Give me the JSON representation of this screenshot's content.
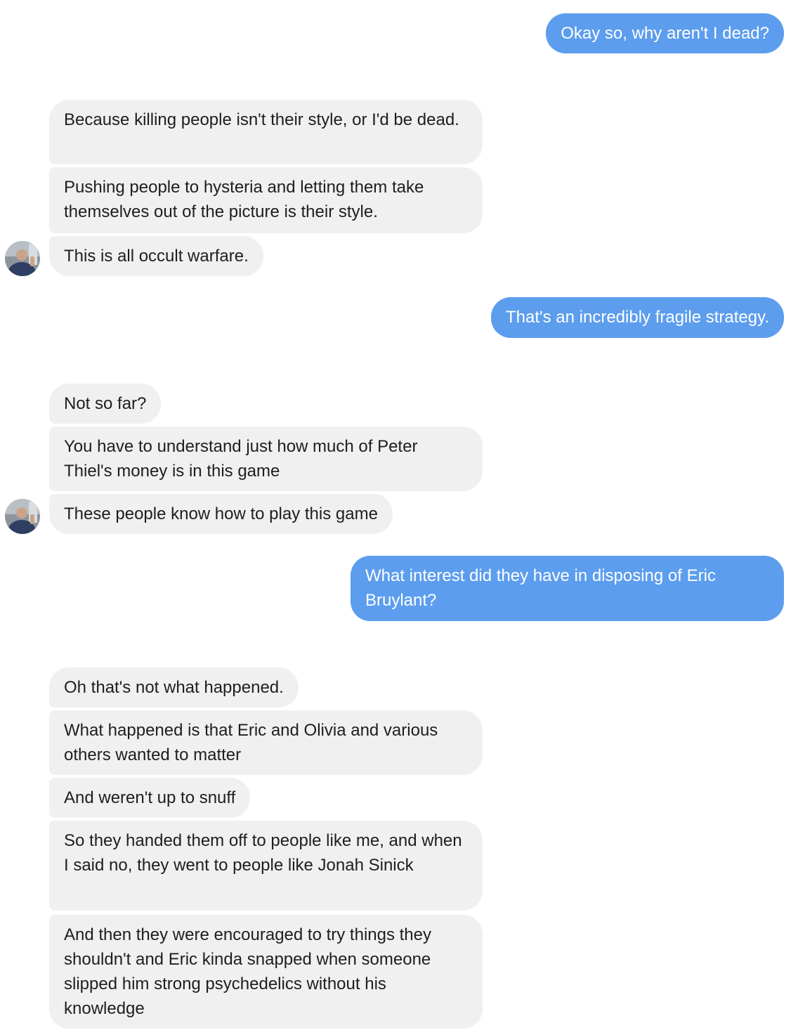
{
  "conversation": {
    "messages": [
      {
        "side": "out",
        "text": "Okay so, why aren't I dead?"
      },
      {
        "side": "in",
        "text": "Because killing people isn't their style, or I'd be dead."
      },
      {
        "side": "in",
        "text": "Pushing people to hysteria and letting them take themselves out of the picture is their style."
      },
      {
        "side": "in",
        "text": "This is all occult warfare."
      },
      {
        "side": "out",
        "text": "That's an incredibly fragile strategy."
      },
      {
        "side": "in",
        "text": "Not so far?"
      },
      {
        "side": "in",
        "text": "You have to understand just how much of Peter Thiel's money is in this game"
      },
      {
        "side": "in",
        "text": "These people know how to play this game"
      },
      {
        "side": "out",
        "text": "What interest did they have in disposing of Eric Bruylant?"
      },
      {
        "side": "in",
        "text": "Oh that's not what happened."
      },
      {
        "side": "in",
        "text": "What happened is that Eric and Olivia and various others wanted to matter"
      },
      {
        "side": "in",
        "text": "And weren't up to snuff"
      },
      {
        "side": "in",
        "text": "So they handed them off to people like me, and when I said no, they went to people like Jonah Sinick"
      },
      {
        "side": "in",
        "text": "And then they were encouraged to try things they shouldn't and Eric kinda snapped when someone slipped him strong psychedelics without his knowledge"
      }
    ]
  },
  "colors": {
    "outgoing_bubble": "#5c9dee",
    "incoming_bubble": "#f0f0f0"
  },
  "icons": {
    "avatar": "contact-avatar-photo"
  }
}
